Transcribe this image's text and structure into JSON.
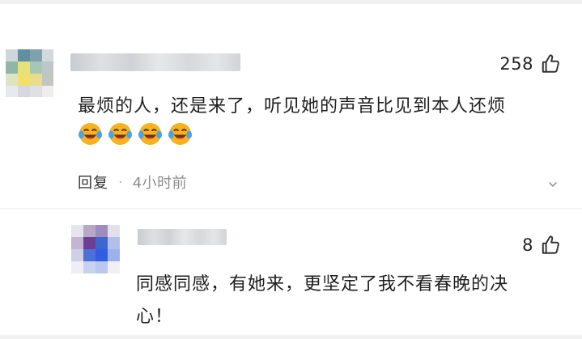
{
  "main_comment": {
    "likes": "258",
    "text": "最烦的人，还是来了，听见她的声音比见到本人还烦",
    "emoji_icons": [
      "laugh-crying-icon",
      "laugh-crying-icon",
      "laugh-crying-icon",
      "laugh-crying-icon"
    ],
    "reply_label": "回复",
    "separator": "·",
    "time": "4小时前"
  },
  "reply_comment": {
    "likes": "8",
    "text_line1": "同感同感，有她来，更坚定了我不看春晚的决",
    "text_line2": "心！"
  },
  "colors": {
    "text": "#1f1f1f",
    "meta_time": "#8e8e8e",
    "icon": "#333333",
    "emoji_face": "#f7b21e"
  }
}
